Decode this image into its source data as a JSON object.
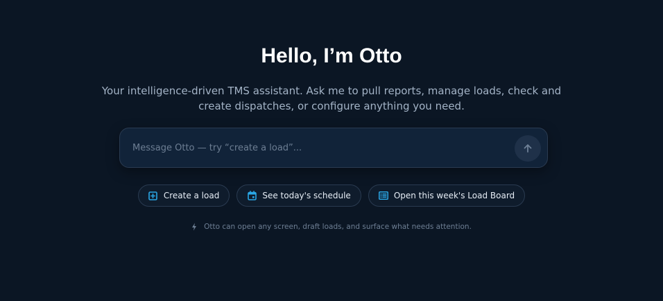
{
  "hero": {
    "title": "Hello, I’m Otto",
    "subtitle": "Your intelligence-driven TMS assistant. Ask me to pull reports, manage loads, check and create dispatches, or configure anything you need."
  },
  "composer": {
    "placeholder": "Message Otto — try “create a load”...",
    "value": "",
    "send_icon": "arrow-up-icon"
  },
  "quick_actions": [
    {
      "label": "Create a load",
      "icon": "plus-square-icon"
    },
    {
      "label": "See today's schedule",
      "icon": "calendar-icon"
    },
    {
      "label": "Open this week's Load Board",
      "icon": "list-board-icon"
    }
  ],
  "hint": {
    "text": "Otto can open any screen, draft loads, and surface what needs attention.",
    "icon": "bolt-icon"
  },
  "colors": {
    "background": "#0b1624",
    "accent": "#2aa7e6",
    "composer_bg": "#112339"
  }
}
